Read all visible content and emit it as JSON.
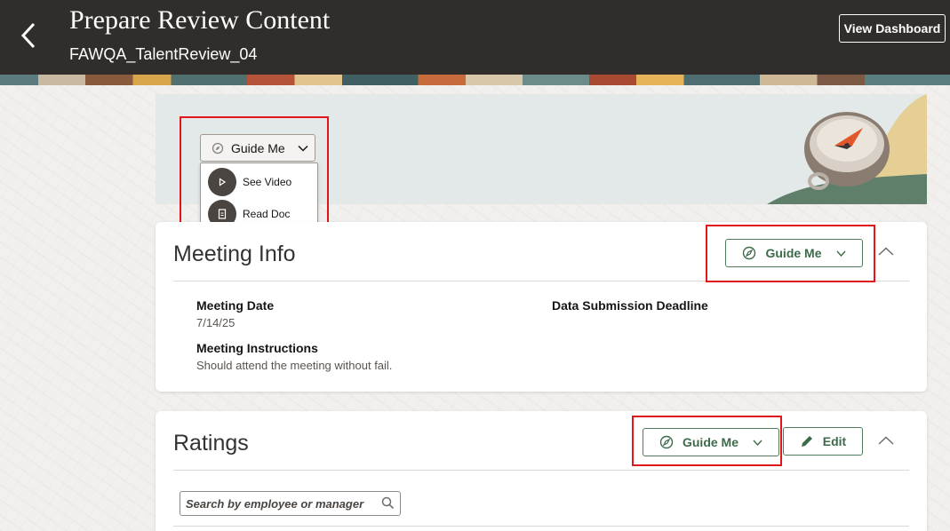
{
  "header": {
    "title": "Prepare Review Content",
    "subtitle": "FAWQA_TalentReview_04",
    "view_dashboard_label": "View Dashboard"
  },
  "hero": {
    "guide_me_label": "Guide Me",
    "menu": [
      {
        "label": "See Video",
        "icon": "play-icon"
      },
      {
        "label": "Read Doc",
        "icon": "document-icon"
      }
    ]
  },
  "meeting_info": {
    "title": "Meeting Info",
    "guide_me_label": "Guide Me",
    "meeting_date_label": "Meeting Date",
    "meeting_date_value": "7/14/25",
    "deadline_label": "Data Submission Deadline",
    "instructions_label": "Meeting Instructions",
    "instructions_value": "Should attend the meeting without fail."
  },
  "ratings": {
    "title": "Ratings",
    "guide_me_label": "Guide Me",
    "edit_label": "Edit",
    "search_placeholder": "Search by employee or manager"
  },
  "colors": {
    "header_bg": "#312d2a",
    "accent_green": "#3d6b4a",
    "highlight_red": "#e0161b"
  }
}
